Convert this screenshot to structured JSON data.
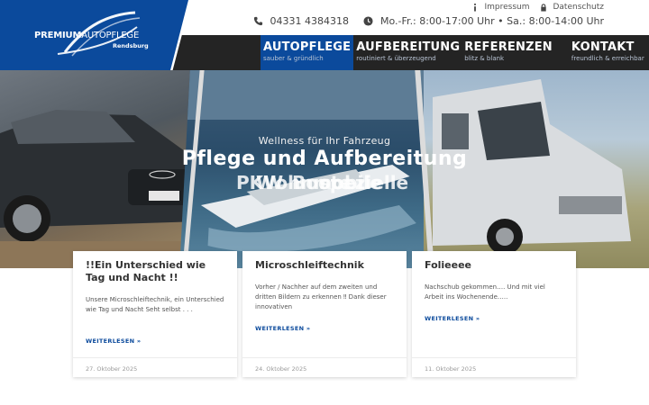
{
  "top_links": [
    {
      "label": "Impressum",
      "icon": "info-icon"
    },
    {
      "label": "Datenschutz",
      "icon": "lock-icon"
    }
  ],
  "contact": {
    "phone": "04331 4384318",
    "hours": "Mo.-Fr.: 8:00-17:00 Uhr • Sa.: 8:00-14:00 Uhr"
  },
  "logo": {
    "word1": "PREMIUM",
    "word2": "AUTOPFLEGE",
    "city": "Rendsburg"
  },
  "nav": [
    {
      "label": "AUTOPFLEGE",
      "sub": "sauber & gründlich",
      "active": true
    },
    {
      "label": "AUFBEREITUNG",
      "sub": "routiniert & überzeugend",
      "active": false
    },
    {
      "label": "REFERENZEN",
      "sub": "blitz & blank",
      "active": false
    },
    {
      "label": "KONTAKT",
      "sub": "freundlich & erreichbar",
      "active": false
    }
  ],
  "hero": {
    "subtitle": "Wellness für Ihr Fahrzeug",
    "title": "Pflege und Aufbereitung",
    "ticker": [
      "PKW",
      "Wohnmobile",
      "Boote",
      "spezielle"
    ]
  },
  "cards": [
    {
      "title": "!!Ein Unterschied wie Tag und Nacht !!",
      "excerpt": "Unsere Microschleiftechnik, ein Unterschied wie Tag und Nacht  Seht selbst . . . ",
      "read_more": "WEITERLESEN »",
      "date": "27. Oktober 2025"
    },
    {
      "title": "Microschleiftechnik",
      "excerpt": "Vorher / Nachher auf dem zweiten und dritten Bildern zu erkennen ‼ Dank dieser innovativen",
      "read_more": "WEITERLESEN »",
      "date": "24. Oktober 2025"
    },
    {
      "title": "Folieeee",
      "excerpt": "Nachschub gekommen…. Und mit viel Arbeit ins Wochenende…..",
      "read_more": "WEITERLESEN »",
      "date": "11. Oktober 2025"
    }
  ],
  "colors": {
    "brand_blue": "#0b4a9c",
    "nav_bg": "#242424"
  }
}
